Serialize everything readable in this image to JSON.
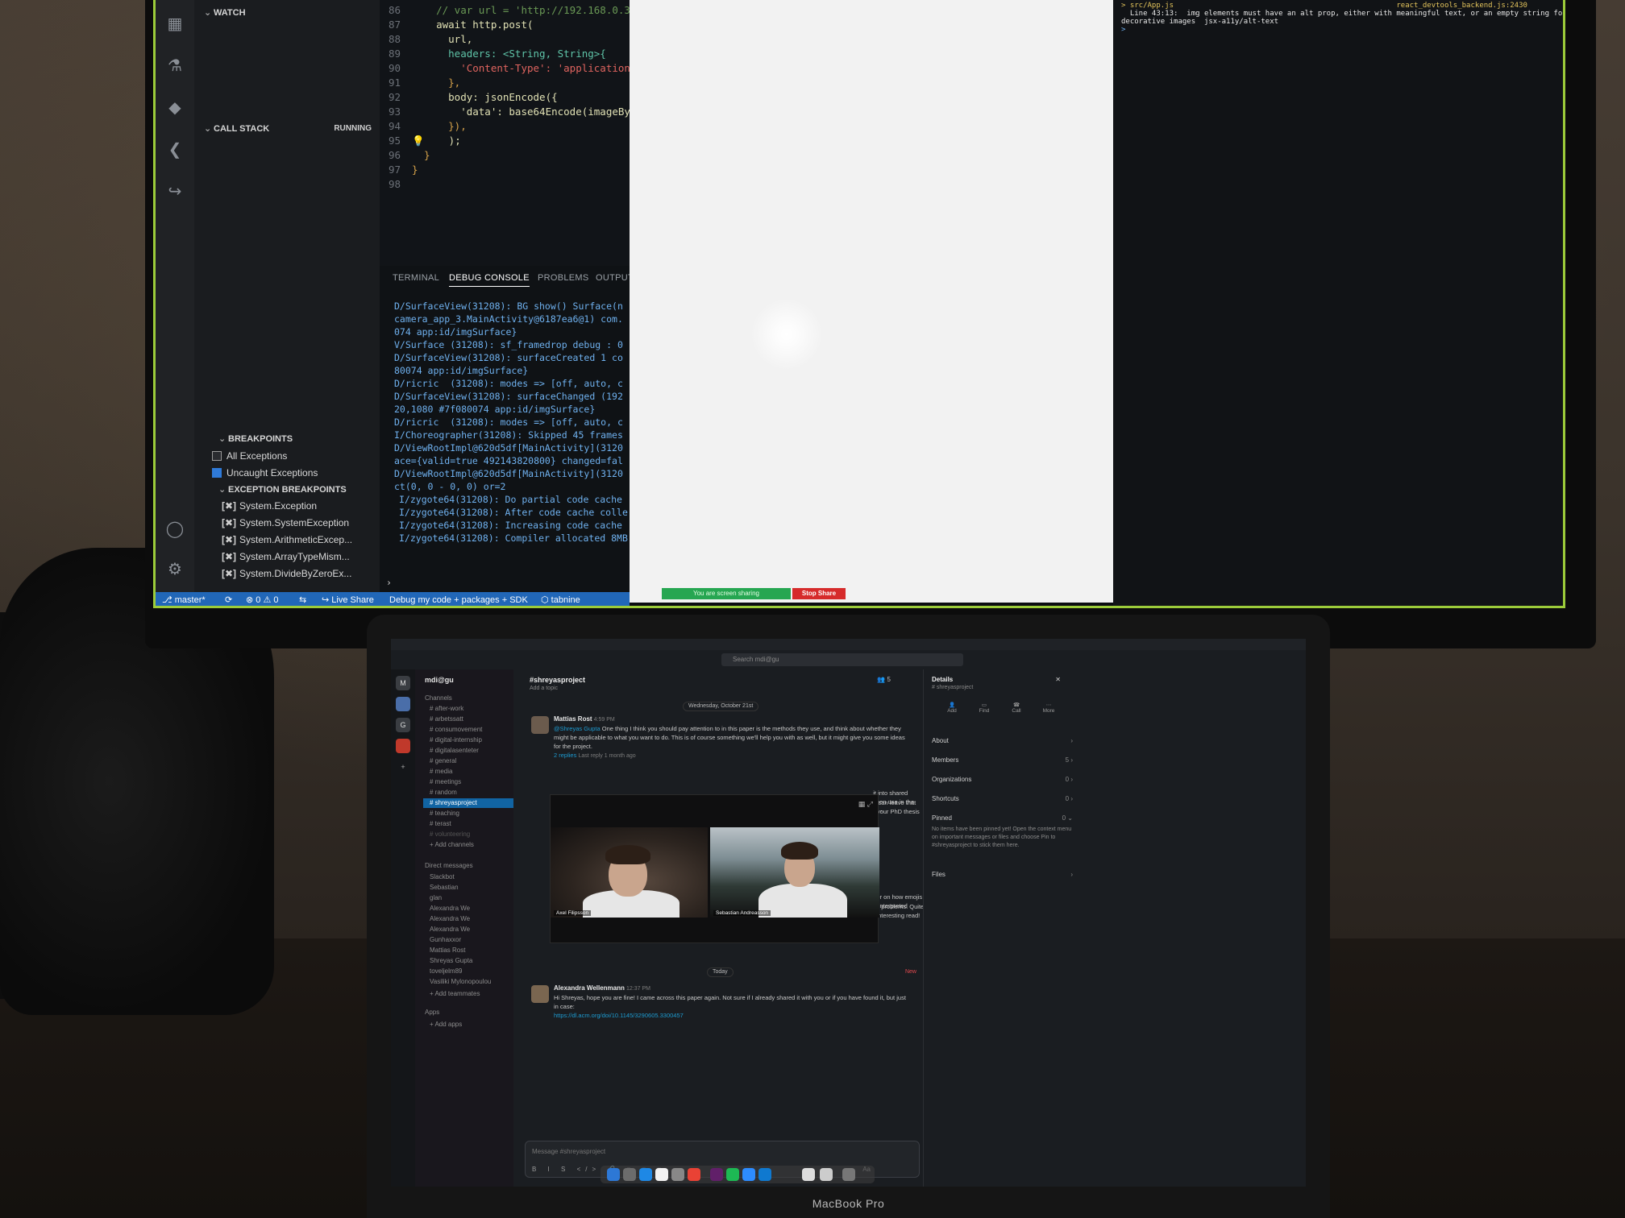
{
  "vscode": {
    "watch_label": "WATCH",
    "callstack_label": "CALL STACK",
    "callstack_status": "RUNNING",
    "breakpoints_label": "BREAKPOINTS",
    "breakpoints": [
      {
        "label": "All Exceptions",
        "checked": false
      },
      {
        "label": "Uncaught Exceptions",
        "checked": true
      }
    ],
    "exception_breakpoints_label": "EXCEPTION BREAKPOINTS",
    "exception_breakpoints": [
      "System.Exception",
      "System.SystemException",
      "System.ArithmeticExcep...",
      "System.ArrayTypeMism...",
      "System.DivideByZeroEx..."
    ],
    "code": [
      {
        "n": "86",
        "text": "    // var url = 'http://192.168.0.32:..."
      },
      {
        "n": "87",
        "text": "    await http.post("
      },
      {
        "n": "88",
        "text": "      url,"
      },
      {
        "n": "89",
        "text": "      headers: <String, String>{"
      },
      {
        "n": "90",
        "text": "        'Content-Type': 'application"
      },
      {
        "n": "91",
        "text": "      },"
      },
      {
        "n": "92",
        "text": "      body: jsonEncode({"
      },
      {
        "n": "93",
        "text": "        'data': base64Encode(imageBy"
      },
      {
        "n": "94",
        "text": "      }),"
      },
      {
        "n": "95",
        "text": "    );"
      },
      {
        "n": "96",
        "text": "  }"
      },
      {
        "n": "97",
        "text": "}"
      },
      {
        "n": "98",
        "text": ""
      }
    ],
    "panel_tabs": [
      "TERMINAL",
      "DEBUG CONSOLE",
      "PROBLEMS",
      "OUTPUT"
    ],
    "console": [
      "D/SurfaceView(31208): BG show() Surface(n",
      "camera_app_3.MainActivity@6187ea6@1) com.",
      "074 app:id/imgSurface}",
      "V/Surface (31208): sf_framedrop debug : 0",
      "D/SurfaceView(31208): surfaceCreated 1 co",
      "80074 app:id/imgSurface}",
      "D/ricric  (31208): modes => [off, auto, c",
      "D/SurfaceView(31208): surfaceChanged (192",
      "20,1080 #7f080074 app:id/imgSurface}",
      "D/ricric  (31208): modes => [off, auto, c",
      "I/Choreographer(31208): Skipped 45 frames",
      "D/ViewRootImpl@620d5df[MainActivity](3120",
      "ace={valid=true 492143820800} changed=fal",
      "D/ViewRootImpl@620d5df[MainActivity](3120",
      "ct(0, 0 - 0, 0) or=2",
      "I/zygote64(31208): Do partial code cache",
      "I/zygote64(31208): After code cache colle",
      "I/zygote64(31208): Increasing code cache",
      "I/zygote64(31208): Compiler allocated 8MB"
    ],
    "status": {
      "branch": "master*",
      "errors": "0",
      "warnings": "0",
      "live_share": "Live Share",
      "debug_config": "Debug my code + packages + SDK",
      "tabnine": "tabnine"
    }
  },
  "screen_share": {
    "sharing_label": "You are screen sharing",
    "stop_label": "Stop Share"
  },
  "right_terminal": {
    "lines": [
      "> src/App.js                                                   react_devtools_backend.js:2430",
      "  Line 43:13:  img elements must have an alt prop, either with meaningful text, or an empty string for",
      "decorative images  jsx-a11y/alt-text",
      ">"
    ]
  },
  "slack": {
    "search_placeholder": "Search mdi@gu",
    "workspace": "mdi@gu",
    "workspace_rail": [
      "M",
      "",
      "G",
      ""
    ],
    "channels_header": "Channels",
    "channels": [
      "after-work",
      "arbetssatt",
      "consumovement",
      "digital-internship",
      "digitalasenteter",
      "general",
      "media",
      "meetings",
      "random",
      "shreyasproject",
      "teaching",
      "terast",
      "volunteering"
    ],
    "active_channel": "shreyasproject",
    "add_channels": "Add channels",
    "dm_header": "Direct messages",
    "dms": [
      "Slackbot",
      "Sebastian",
      "glan",
      "Alexandra We",
      "Alexandra We",
      "Alexandra We",
      "Gunhaxxor",
      "Mattias Rost",
      "Shreyas Gupta",
      "toveljelm89",
      "Vasiliki Mylonopoulou"
    ],
    "add_teammates": "Add teammates",
    "apps_header": "Apps",
    "add_apps": "Add apps",
    "channel_title": "#shreyasproject",
    "channel_topic": "Add a topic",
    "member_count": "5",
    "date_divider_1": "Wednesday, October 21st",
    "msg1": {
      "author": "Mattias Rost",
      "time": "4:59 PM",
      "mention": "@Shreyas Gupta",
      "text": "One thing I think you should pay attention to in this paper is the methods they use, and think about whether they might be applicable to what you want to do. This is of course something we'll help you with as well, but it might give you some ideas for the project.",
      "replies": "2 replies",
      "last_reply": "Last reply 1 month ago"
    },
    "partial_text_1": "...it into shared screen use in the wild -",
    "partial_text_2": "...u can leave that for your PhD thesis",
    "partial_text_3": "...per on how emojis are interpreted",
    "partial_text_4": "...se problems. Quite an interesting read!",
    "date_divider_2": "Today",
    "new_label": "New",
    "msg2": {
      "author": "Alexandra Wellenmann",
      "time": "12:37 PM",
      "text": "Hi Shreyas, hope you are fine! I came across this paper again. Not sure if I already shared it with you or if you have found it, but just in case:",
      "link": "https://dl.acm.org/doi/10.1145/3290605.3300457"
    },
    "composer_placeholder": "Message #shreyasproject",
    "composer_tools": "B I S </> 🔗 ≡ ≡ ≡",
    "composer_aa": "Aa",
    "details": {
      "title": "Details",
      "subtitle": "# shreyasproject",
      "actions": [
        "Add",
        "Find",
        "Call",
        "More"
      ],
      "about": "About",
      "members": "Members",
      "members_count": "5",
      "organizations": "Organizations",
      "organizations_count": "0",
      "shortcuts": "Shortcuts",
      "shortcuts_count": "0",
      "pinned": "Pinned",
      "pinned_count": "0",
      "pinned_empty": "No items have been pinned yet! Open the context menu on important messages or files and choose Pin to #shreyasproject to stick them here.",
      "files": "Files"
    }
  },
  "zoom": {
    "participants": [
      "Axel Filipsson",
      "Sebastian Andreasson"
    ]
  },
  "laptop_brand": "MacBook Pro"
}
